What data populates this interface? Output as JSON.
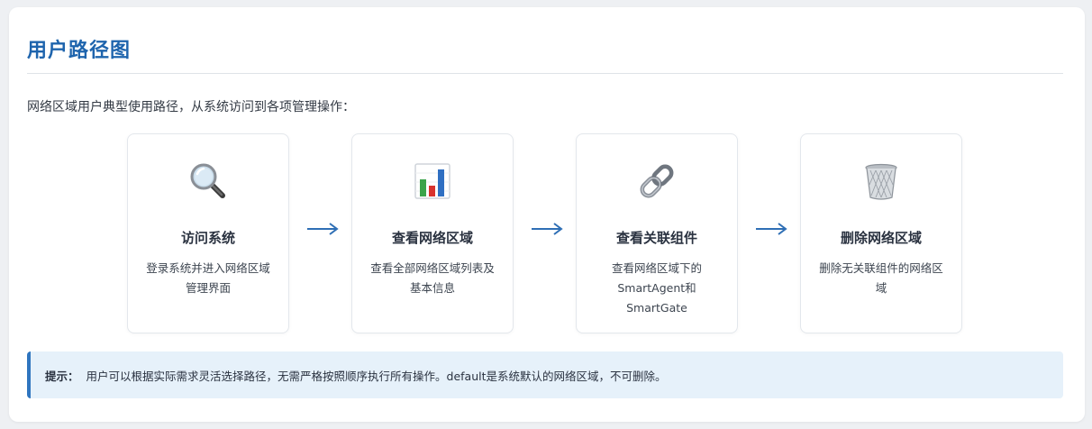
{
  "page": {
    "title": "用户路径图",
    "intro": "网络区域用户典型使用路径，从系统访问到各项管理操作："
  },
  "steps": [
    {
      "icon": "magnifier-icon",
      "title": "访问系统",
      "desc": "登录系统并进入网络区域管理界面"
    },
    {
      "icon": "bar-chart-icon",
      "title": "查看网络区域",
      "desc": "查看全部网络区域列表及基本信息"
    },
    {
      "icon": "chain-link-icon",
      "title": "查看关联组件",
      "desc": "查看网络区域下的SmartAgent和SmartGate"
    },
    {
      "icon": "trash-bin-icon",
      "title": "删除网络区域",
      "desc": "删除无关联组件的网络区域"
    }
  ],
  "tip": {
    "label": "提示：",
    "text": "用户可以根据实际需求灵活选择路径，无需严格按照顺序执行所有操作。default是系统默认的网络区域，不可删除。"
  },
  "colors": {
    "accent": "#1e64ad",
    "tip_background": "#e6f1fa",
    "tip_border": "#2f75bf"
  }
}
